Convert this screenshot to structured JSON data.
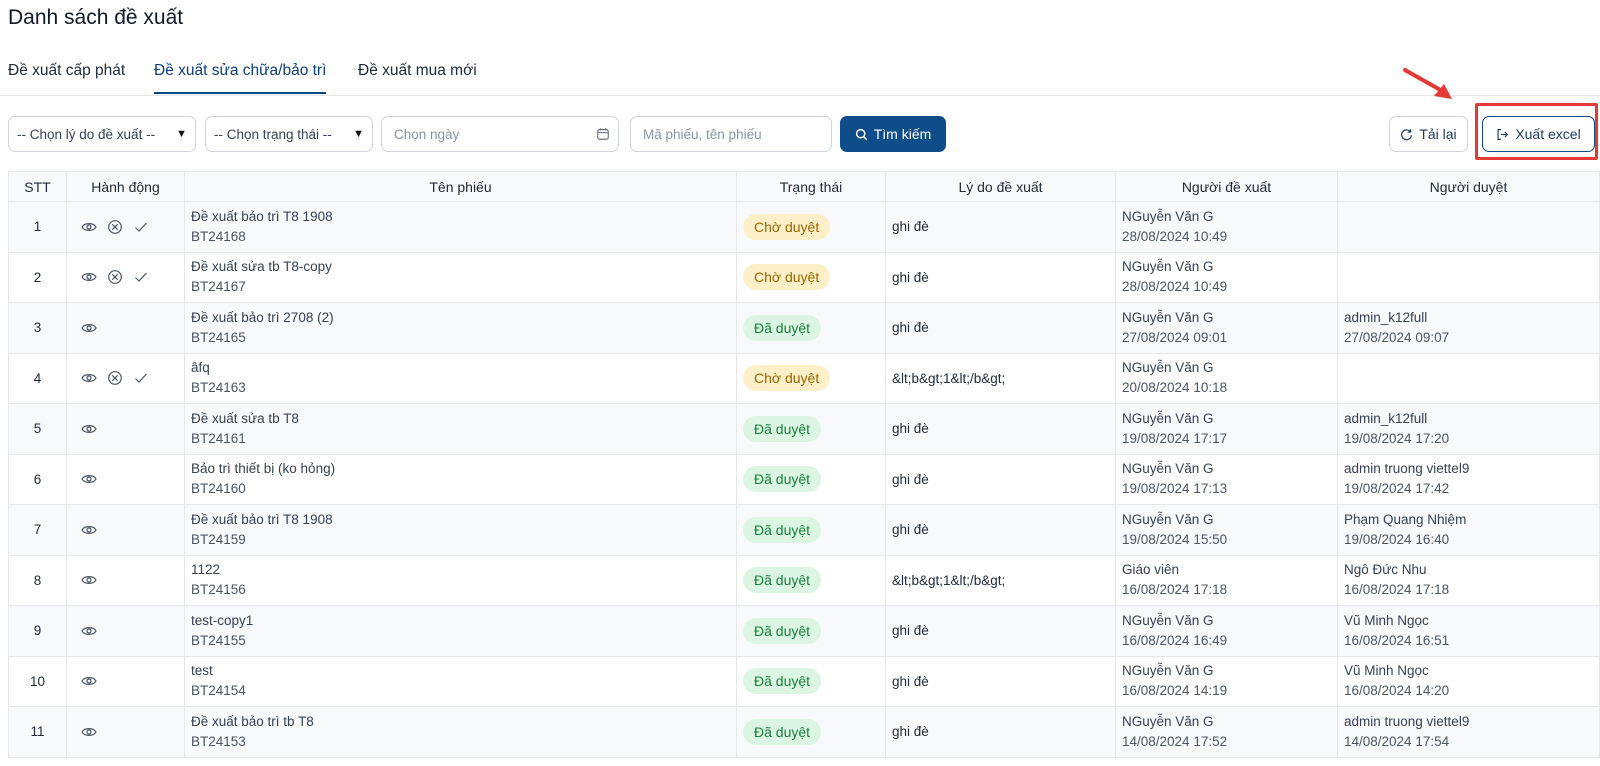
{
  "page": {
    "title": "Danh sách đề xuất"
  },
  "tabs": [
    {
      "label": "Đề xuất cấp phát",
      "active": false
    },
    {
      "label": "Đề xuất sửa chữa/bảo trì",
      "active": true
    },
    {
      "label": "Đề xuất mua mới",
      "active": false
    }
  ],
  "filters": {
    "reason_select": "-- Chọn lý do đề xuất --",
    "status_select": "-- Chọn trạng thái --",
    "date_placeholder": "Chọn ngày",
    "search_placeholder": "Mã phiếu, tên phiếu",
    "search_button": "Tìm kiếm",
    "reload_button": "Tải lại",
    "export_button": "Xuất excel"
  },
  "table": {
    "headers": [
      "STT",
      "Hành động",
      "Tên phiếu",
      "Trạng thái",
      "Lý do đề xuất",
      "Người đề xuất",
      "Người duyệt"
    ],
    "rows": [
      {
        "stt": "1",
        "actions": [
          "view",
          "cancel",
          "approve"
        ],
        "name": "Đề xuất bảo trì T8 1908",
        "code": "BT24168",
        "status": "Chờ duyệt",
        "status_type": "pending",
        "reason": "ghi đè",
        "proposer": "NGuyễn Văn G",
        "proposed_at": "28/08/2024 10:49",
        "approver": "",
        "approved_at": ""
      },
      {
        "stt": "2",
        "actions": [
          "view",
          "cancel",
          "approve"
        ],
        "name": "Đề xuất sửa tb T8-copy",
        "code": "BT24167",
        "status": "Chờ duyệt",
        "status_type": "pending",
        "reason": "ghi đè",
        "proposer": "NGuyễn Văn G",
        "proposed_at": "28/08/2024 10:49",
        "approver": "",
        "approved_at": ""
      },
      {
        "stt": "3",
        "actions": [
          "view"
        ],
        "name": "Đề xuất bảo trì 2708 (2)",
        "code": "BT24165",
        "status": "Đã duyệt",
        "status_type": "approved",
        "reason": "ghi đè",
        "proposer": "NGuyễn Văn G",
        "proposed_at": "27/08/2024 09:01",
        "approver": "admin_k12full",
        "approved_at": "27/08/2024 09:07"
      },
      {
        "stt": "4",
        "actions": [
          "view",
          "cancel",
          "approve"
        ],
        "name": "âfq",
        "code": "BT24163",
        "status": "Chờ duyệt",
        "status_type": "pending",
        "reason": "&lt;b&gt;1&lt;/b&gt;",
        "proposer": "NGuyễn Văn G",
        "proposed_at": "20/08/2024 10:18",
        "approver": "",
        "approved_at": ""
      },
      {
        "stt": "5",
        "actions": [
          "view"
        ],
        "name": "Đề xuất sửa tb T8",
        "code": "BT24161",
        "status": "Đã duyệt",
        "status_type": "approved",
        "reason": "ghi đè",
        "proposer": "NGuyễn Văn G",
        "proposed_at": "19/08/2024 17:17",
        "approver": "admin_k12full",
        "approved_at": "19/08/2024 17:20"
      },
      {
        "stt": "6",
        "actions": [
          "view"
        ],
        "name": "Bảo trì thiết bị (ko hỏng)",
        "code": "BT24160",
        "status": "Đã duyệt",
        "status_type": "approved",
        "reason": "ghi đè",
        "proposer": "NGuyễn Văn G",
        "proposed_at": "19/08/2024 17:13",
        "approver": "admin truong viettel9",
        "approved_at": "19/08/2024 17:42"
      },
      {
        "stt": "7",
        "actions": [
          "view"
        ],
        "name": "Đề xuất bảo trì T8 1908",
        "code": "BT24159",
        "status": "Đã duyệt",
        "status_type": "approved",
        "reason": "ghi đè",
        "proposer": "NGuyễn Văn G",
        "proposed_at": "19/08/2024 15:50",
        "approver": "Phạm Quang Nhiệm",
        "approved_at": "19/08/2024 16:40"
      },
      {
        "stt": "8",
        "actions": [
          "view"
        ],
        "name": "1122",
        "code": "BT24156",
        "status": "Đã duyệt",
        "status_type": "approved",
        "reason": "&lt;b&gt;1&lt;/b&gt;",
        "proposer": "Giáo viên",
        "proposed_at": "16/08/2024 17:18",
        "approver": "Ngô Đức Nhu",
        "approved_at": "16/08/2024 17:18"
      },
      {
        "stt": "9",
        "actions": [
          "view"
        ],
        "name": "test-copy1",
        "code": "BT24155",
        "status": "Đã duyệt",
        "status_type": "approved",
        "reason": "ghi đè",
        "proposer": "NGuyễn Văn G",
        "proposed_at": "16/08/2024 16:49",
        "approver": "Vũ Minh Ngọc",
        "approved_at": "16/08/2024 16:51"
      },
      {
        "stt": "10",
        "actions": [
          "view"
        ],
        "name": "test",
        "code": "BT24154",
        "status": "Đã duyệt",
        "status_type": "approved",
        "reason": "ghi đè",
        "proposer": "NGuyễn Văn G",
        "proposed_at": "16/08/2024 14:19",
        "approver": "Vũ Minh Ngọc",
        "approved_at": "16/08/2024 14:20"
      },
      {
        "stt": "11",
        "actions": [
          "view"
        ],
        "name": "Đề xuất bảo trì tb T8",
        "code": "BT24153",
        "status": "Đã duyệt",
        "status_type": "approved",
        "reason": "ghi đè",
        "proposer": "NGuyễn Văn G",
        "proposed_at": "14/08/2024 17:52",
        "approver": "admin truong viettel9",
        "approved_at": "14/08/2024 17:54"
      }
    ]
  },
  "colors": {
    "primary": "#0f4c8a",
    "pending_bg": "#fdefc8",
    "pending_text": "#9a6700",
    "approved_bg": "#dcf5e3",
    "approved_text": "#17803d",
    "highlight": "#e53935"
  },
  "icons": {
    "view": "eye-icon",
    "cancel": "circle-x-icon",
    "approve": "check-icon",
    "search": "search-icon",
    "reload": "refresh-icon",
    "export": "export-icon",
    "calendar": "calendar-icon"
  }
}
